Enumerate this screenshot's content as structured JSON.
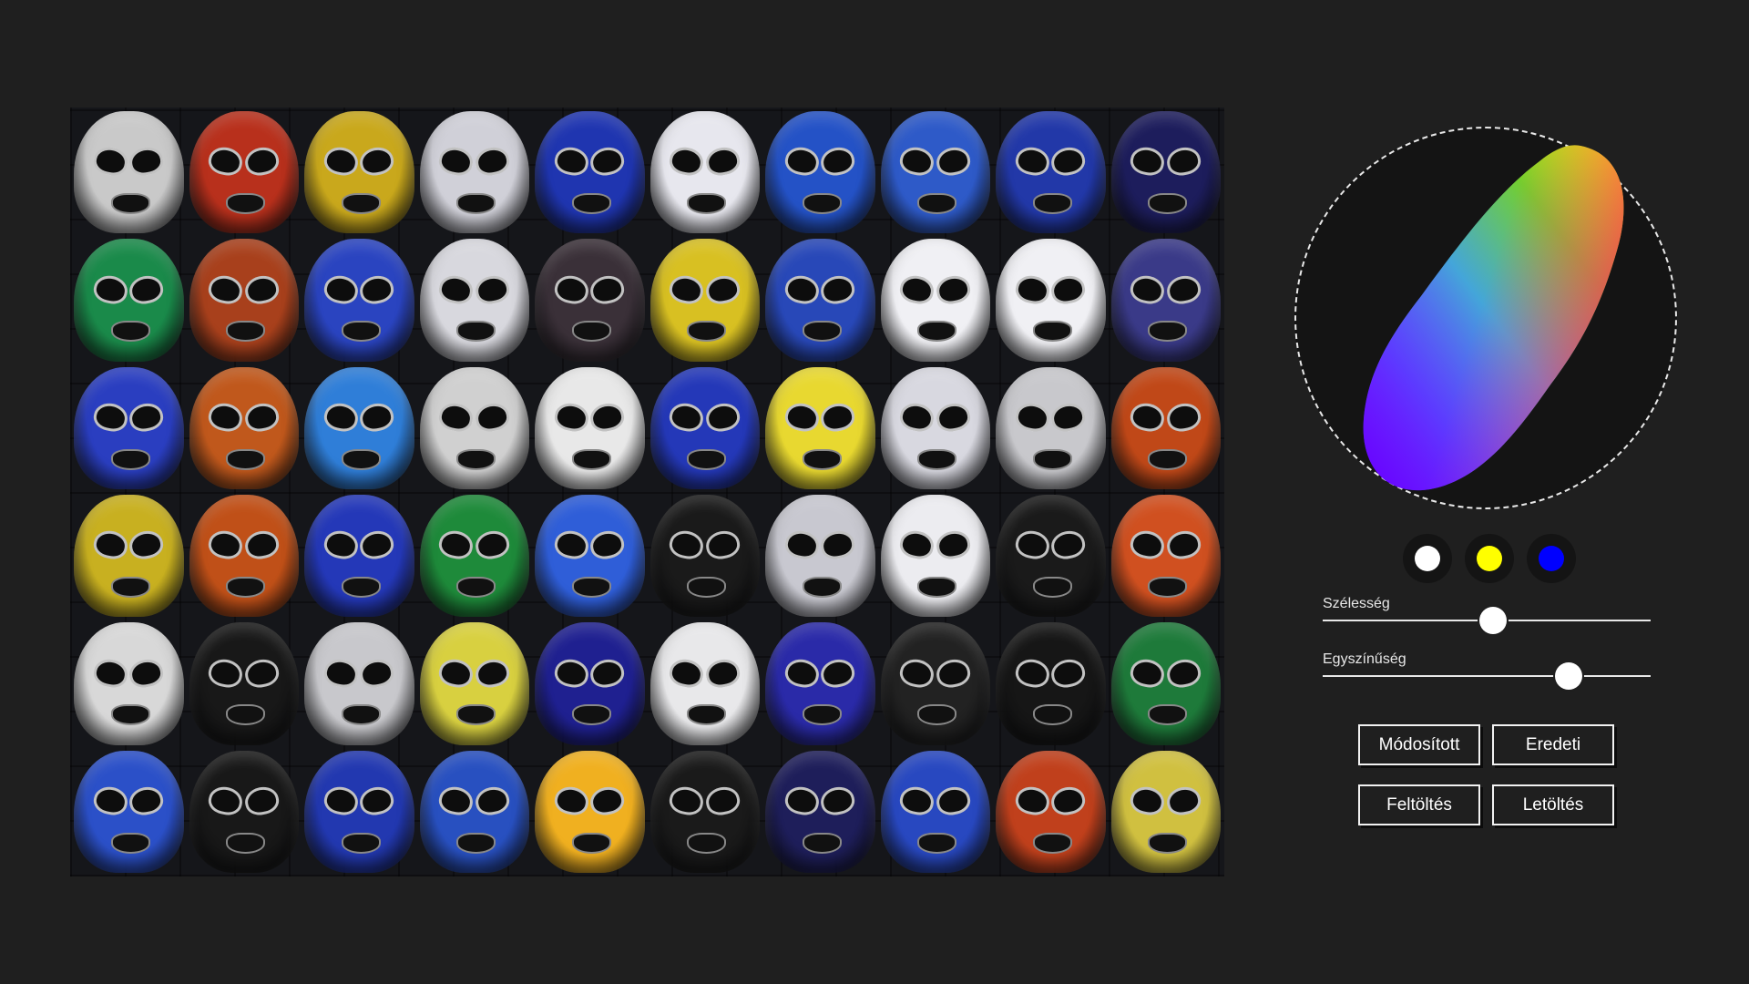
{
  "image": {
    "description_alt": "",
    "mask_colors": [
      [
        "#c9c9c9",
        "#b8301c",
        "#c9a81c",
        "#d0d0d8",
        "#1f35b0",
        "#e7e7ee",
        "#2452c6",
        "#2e5ac8",
        "#2238a8",
        "#1d1d5c"
      ],
      [
        "#1a8a4a",
        "#a8401c",
        "#2a44c0",
        "#d8d8de",
        "#3a3038",
        "#d8c022",
        "#2848b8",
        "#f0f0f4",
        "#f0f0f4",
        "#3a3a88"
      ],
      [
        "#2a3ec0",
        "#c0581c",
        "#2f7ed8",
        "#d0d0d0",
        "#e8e8e8",
        "#2438b8",
        "#e8d830",
        "#d8d8e0",
        "#c8c8cc",
        "#c04818"
      ],
      [
        "#c8b020",
        "#c05018",
        "#2438b8",
        "#1e8a3a",
        "#2f5ed8",
        "#1a1a1a",
        "#c8c8d0",
        "#ececf0",
        "#1a1a1a",
        "#d05020"
      ],
      [
        "#d8d8d8",
        "#181818",
        "#c8c8cc",
        "#d8d040",
        "#1f2090",
        "#e8e8ea",
        "#2a2aa8",
        "#222222",
        "#161616",
        "#1e7a3a"
      ],
      [
        "#2b50c8",
        "#181818",
        "#2238b0",
        "#2850c0",
        "#f0b020",
        "#1a1a1a",
        "#1e1e5a",
        "#2848c0",
        "#c0401c",
        "#d0c040"
      ]
    ]
  },
  "color_wheel": {
    "gradient_colors": [
      "#ffff00",
      "#ff9900",
      "#ff3366",
      "#cc33ff",
      "#3300ff",
      "#00aaff",
      "#00cc66"
    ]
  },
  "swatches": [
    {
      "name": "white",
      "color": "#ffffff"
    },
    {
      "name": "yellow",
      "color": "#ffff00"
    },
    {
      "name": "blue",
      "color": "#0000ff"
    }
  ],
  "sliders": {
    "width": {
      "label": "Szélesség",
      "value": 0.52
    },
    "uniformity": {
      "label": "Egyszínűség",
      "value": 0.75
    }
  },
  "buttons": {
    "modified": "Módosított",
    "original": "Eredeti",
    "upload": "Feltöltés",
    "download": "Letöltés"
  }
}
